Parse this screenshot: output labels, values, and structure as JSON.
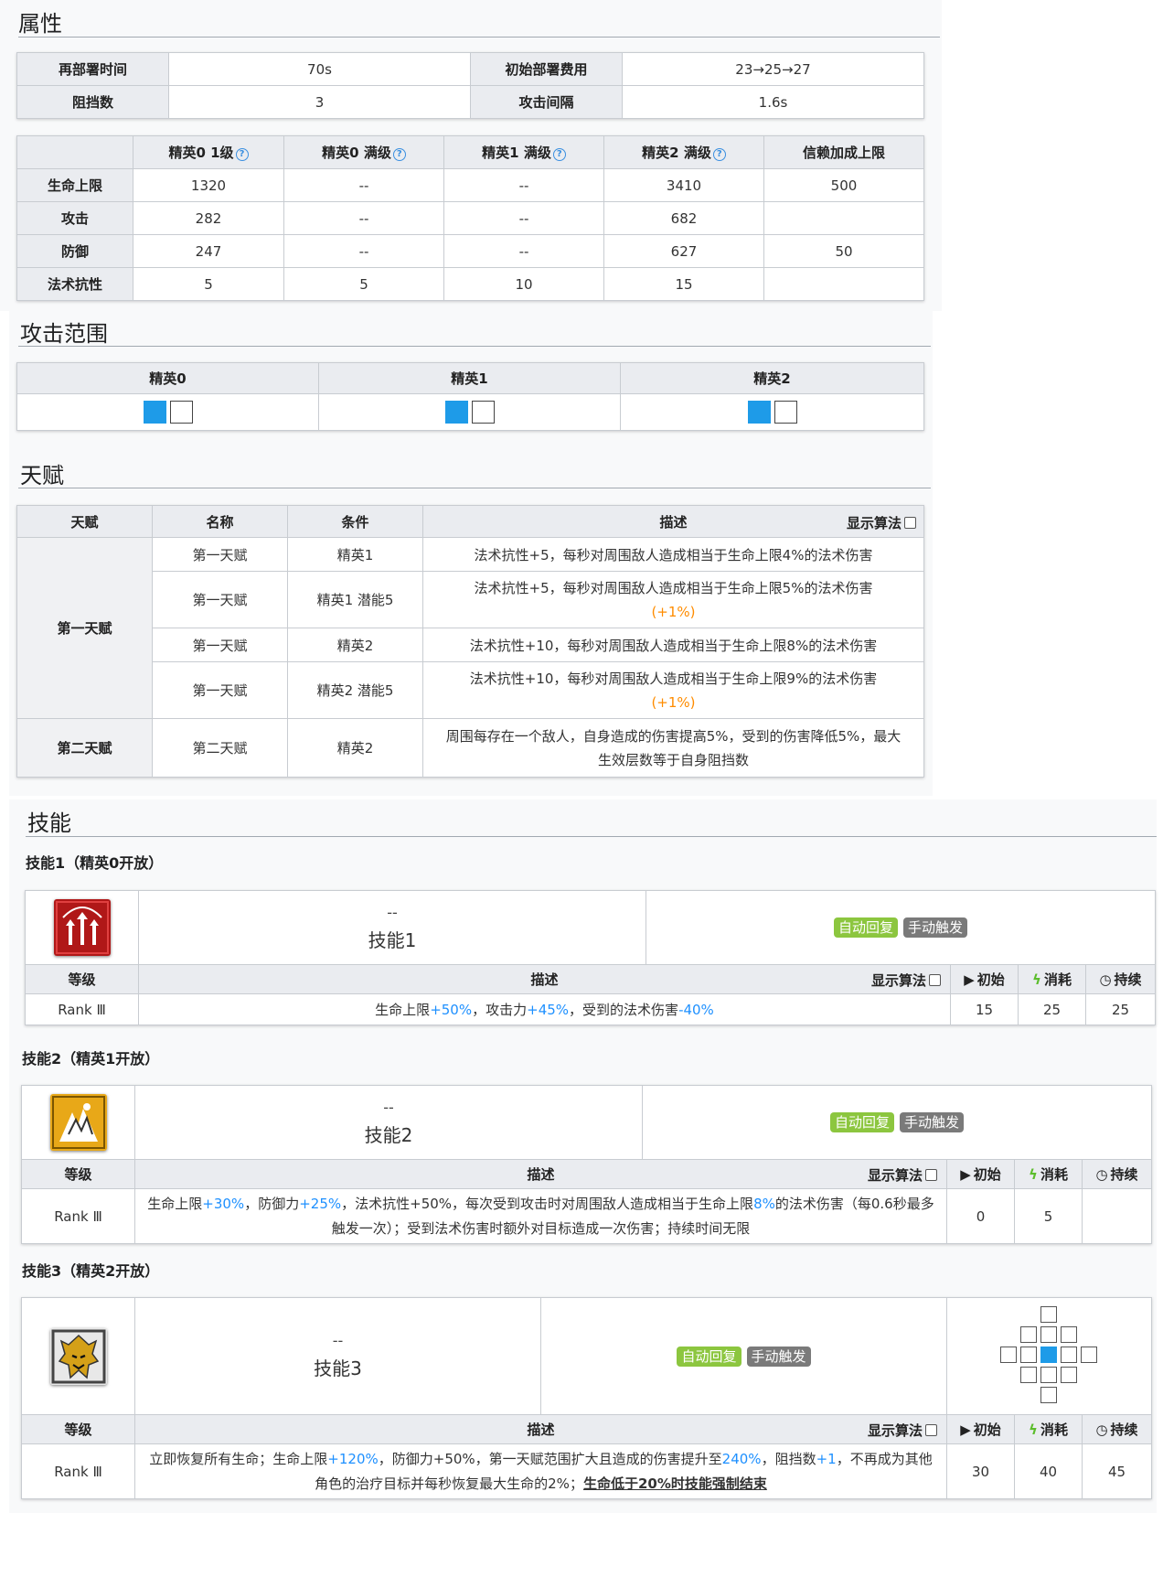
{
  "sections": {
    "attributes": "属性",
    "range": "攻击范围",
    "talents": "天赋",
    "skills": "技能"
  },
  "attr": {
    "redeploy_label": "再部署时间",
    "redeploy": "70s",
    "cost_label": "初始部署费用",
    "cost": "23→25→27",
    "block_label": "阻挡数",
    "block": "3",
    "interval_label": "攻击间隔",
    "interval": "1.6s"
  },
  "stats": {
    "headers": [
      "精英0 1级",
      "精英0 满级",
      "精英1 满级",
      "精英2 满级",
      "信赖加成上限"
    ],
    "rows": [
      {
        "label": "生命上限",
        "values": [
          "1320",
          "--",
          "--",
          "3410"
        ],
        "trust": "500"
      },
      {
        "label": "攻击",
        "values": [
          "282",
          "--",
          "--",
          "682"
        ],
        "trust": ""
      },
      {
        "label": "防御",
        "values": [
          "247",
          "--",
          "--",
          "627"
        ],
        "trust": "50"
      },
      {
        "label": "法术抗性",
        "values": [
          "5",
          "5",
          "10",
          "15"
        ],
        "trust": ""
      }
    ]
  },
  "range": {
    "headers": [
      "精英0",
      "精英1",
      "精英2"
    ]
  },
  "talents": {
    "headers": {
      "talent": "天赋",
      "name": "名称",
      "condition": "条件",
      "desc": "描述",
      "toggle": "显示算法"
    },
    "group1": "第一天赋",
    "group2": "第二天赋",
    "rows": [
      {
        "name": "第一天赋",
        "cond": "精英1",
        "desc": "法术抗性+5，每秒对周围敌人造成相当于生命上限4%的法术伤害",
        "extra": ""
      },
      {
        "name": "第一天赋",
        "cond": "精英1 潜能5",
        "desc": "法术抗性+5，每秒对周围敌人造成相当于生命上限5%的法术伤害",
        "extra": "(+1%)"
      },
      {
        "name": "第一天赋",
        "cond": "精英2",
        "desc": "法术抗性+10，每秒对周围敌人造成相当于生命上限8%的法术伤害",
        "extra": ""
      },
      {
        "name": "第一天赋",
        "cond": "精英2 潜能5",
        "desc": "法术抗性+10，每秒对周围敌人造成相当于生命上限9%的法术伤害",
        "extra": "(+1%)"
      },
      {
        "name": "第二天赋",
        "cond": "精英2",
        "desc": "周围每存在一个敌人，自身造成的伤害提高5%，受到的伤害降低5%，最大生效层数等于自身阻挡数",
        "extra": ""
      }
    ]
  },
  "skill_common": {
    "level": "等级",
    "desc": "描述",
    "toggle": "显示算法",
    "init": "初始",
    "cost": "消耗",
    "dur": "持续",
    "auto": "自动回复",
    "manual": "手动触发",
    "dash": "--",
    "rank": "Rank Ⅲ"
  },
  "skill1": {
    "title": "技能1（精英0开放）",
    "name": "技能1",
    "d1": "生命上限",
    "v1": "+50%",
    "d2": "，攻击力",
    "v2": "+45%",
    "d3": "，受到的法术伤害",
    "v3": "-40%",
    "init": "15",
    "cost": "25",
    "dur": "25"
  },
  "skill2": {
    "title": "技能2（精英1开放）",
    "name": "技能2",
    "d1": "生命上限",
    "v1": "+30%",
    "d2": "，防御力",
    "v2": "+25%",
    "d3": "，法术抗性+50%，每次受到攻击时对周围敌人造成相当于生命上限",
    "v3": "8%",
    "d4": "的法术伤害（每0.6秒最多触发一次）；受到法术伤害时额外对目标造成一次伤害；持续时间无限",
    "init": "0",
    "cost": "5",
    "dur": ""
  },
  "skill3": {
    "title": "技能3（精英2开放）",
    "name": "技能3",
    "d1": "立即恢复所有生命；生命上限",
    "v1": "+120%",
    "d2": "，防御力+50%，第一天赋范围扩大且造成的伤害提升至",
    "v2": "240%",
    "d3": "，阻挡数",
    "v3": "+1",
    "d4": "，不再成为其他角色的治疗目标并每秒恢复最大生命的2%；",
    "d5": "生命低于20%时技能强制结束",
    "init": "30",
    "cost": "40",
    "dur": "45"
  }
}
